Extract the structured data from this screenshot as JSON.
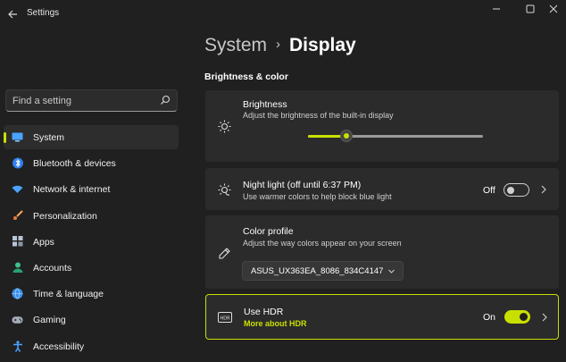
{
  "window": {
    "title": "Settings",
    "controls": [
      "minimize-icon",
      "maximize-icon",
      "close-icon"
    ]
  },
  "search": {
    "placeholder": "Find a setting",
    "icon": "search-icon"
  },
  "sidebar": {
    "items": [
      {
        "label": "System",
        "icon": "monitor-icon",
        "active": true
      },
      {
        "label": "Bluetooth & devices",
        "icon": "bluetooth-icon"
      },
      {
        "label": "Network & internet",
        "icon": "wifi-icon"
      },
      {
        "label": "Personalization",
        "icon": "brush-icon"
      },
      {
        "label": "Apps",
        "icon": "apps-icon"
      },
      {
        "label": "Accounts",
        "icon": "person-icon"
      },
      {
        "label": "Time & language",
        "icon": "globe-icon"
      },
      {
        "label": "Gaming",
        "icon": "gamepad-icon"
      },
      {
        "label": "Accessibility",
        "icon": "accessibility-icon"
      }
    ]
  },
  "breadcrumb": {
    "parent": "System",
    "separator": "›",
    "current": "Display"
  },
  "section": {
    "title": "Brightness & color"
  },
  "brightness": {
    "title": "Brightness",
    "subtitle": "Adjust the brightness of the built-in display",
    "level_fraction": 0.22,
    "icon": "sun-icon"
  },
  "night_light": {
    "title": "Night light (off until 6:37 PM)",
    "subtitle": "Use warmer colors to help block blue light",
    "state": "Off",
    "icon": "sun-moon-icon"
  },
  "color_profile": {
    "title": "Color profile",
    "subtitle": "Adjust the way colors appear on your screen",
    "selected": "ASUS_UX363EA_8086_834C4147",
    "icon": "eyedropper-icon"
  },
  "hdr": {
    "title": "Use HDR",
    "link": "More about HDR",
    "state": "On",
    "icon": "hdr-icon"
  },
  "colors": {
    "accent": "#c8e000",
    "background": "#202020",
    "card": "#2b2b2b"
  }
}
